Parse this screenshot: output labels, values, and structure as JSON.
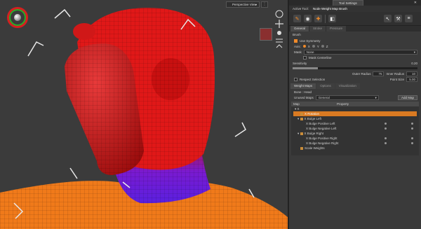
{
  "viewport": {
    "view_menu_label": "Perspective View",
    "colors": {
      "background": "#3b3b3b",
      "mesh_red": "#e01818",
      "mesh_orange": "#f07a1a",
      "weight_purple": "#6a20d8",
      "wire": "#222222"
    }
  },
  "panel": {
    "tab_label": "Tool Settings",
    "active_tool_label": "Active Tool:",
    "active_tool_name": "Node Weight Map Brush",
    "tool_icons": [
      "brush-icon",
      "smooth-icon",
      "paint-icon",
      "gradient-icon",
      "select-icon",
      "tweak-icon",
      "settings-icon"
    ],
    "subtabs": [
      "General",
      "Stroke",
      "Pressure"
    ],
    "brush_section": "Brush",
    "use_symmetry": "Use Symmetry",
    "axis_label": "Axis:",
    "axes": [
      "X",
      "Y",
      "Z"
    ],
    "mask_label": "Mask",
    "mask_value": "None",
    "mask_centerline": "Mask Centerline",
    "sensitivity_label": "Sensitivity",
    "sensitivity_value": "0.20",
    "outer_radius_label": "Outer Radius",
    "outer_radius_value": "75",
    "inner_radius_label": "Inner Radius",
    "inner_radius_value": "10",
    "respect_selection": "Respect Selection",
    "point_size_label": "Point Size",
    "point_size_value": "5.00",
    "weight_tabs": [
      "Weight Maps",
      "Options",
      "Visualization"
    ],
    "bone_label": "Bone : Head",
    "unused_maps_label": "Unused Maps",
    "unused_maps_value": "General",
    "add_map_label": "Add Map",
    "tree_columns": [
      "Map",
      "Property"
    ],
    "tree_rows": [
      {
        "label": "X",
        "indent": 0,
        "selected": false
      },
      {
        "label": "X Rotation",
        "indent": 1,
        "selected": true
      },
      {
        "label": "X Bulge Left",
        "indent": 1,
        "selected": false
      },
      {
        "label": "X Bulge Positive Left",
        "indent": 2,
        "selected": false
      },
      {
        "label": "X Bulge Negative Left",
        "indent": 2,
        "selected": false
      },
      {
        "label": "X Bulge Right",
        "indent": 1,
        "selected": false
      },
      {
        "label": "X Bulge Positive Right",
        "indent": 2,
        "selected": false
      },
      {
        "label": "X Bulge Negative Right",
        "indent": 2,
        "selected": false
      },
      {
        "label": "Scale Weights",
        "indent": 1,
        "selected": false
      }
    ]
  }
}
